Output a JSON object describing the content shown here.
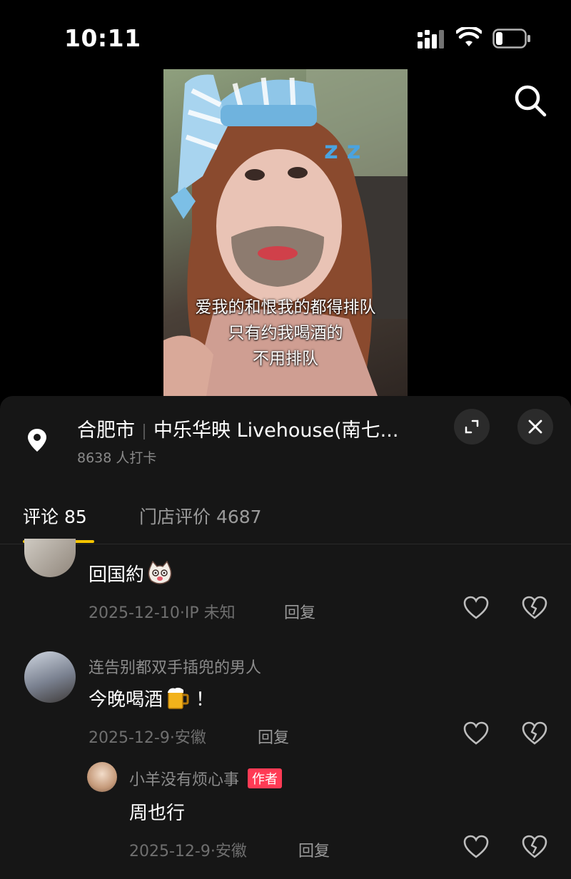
{
  "status_bar": {
    "time": "10:11",
    "icons": [
      "signal-icon",
      "wifi-icon",
      "battery-icon"
    ]
  },
  "header": {
    "search_icon": "search-icon"
  },
  "video": {
    "caption_lines": [
      "爱我的和恨我的都得排队",
      "只有约我喝酒的",
      "不用排队"
    ]
  },
  "location": {
    "city": "合肥市",
    "venue": "中乐华映 Livehouse(南七...",
    "checkins": "8638 人打卡",
    "icons": [
      "location-pin-icon",
      "expand-icon",
      "close-icon"
    ]
  },
  "tabs": [
    {
      "label": "评论 85",
      "active": true
    },
    {
      "label": "门店评价 4687",
      "active": false
    }
  ],
  "comments": [
    {
      "text": "回国約",
      "date": "2025-12-10·IP 未知",
      "reply_label": "回复",
      "emoji": "cat-face-emoji"
    },
    {
      "author": "连告别都双手插兜的男人",
      "text": "今晚喝酒",
      "text_suffix": "！",
      "date": "2025-12-9·安徽",
      "reply_label": "回复",
      "emoji": "beer-mug-emoji"
    },
    {
      "author": "小羊没有烦心事",
      "badge": "作者",
      "text": "周也行",
      "date": "2025-12-9·安徽",
      "reply_label": "回复",
      "is_reply": true
    }
  ],
  "colors": {
    "background": "#000000",
    "sheet": "#161616",
    "accent_underline": "#f5c400",
    "author_badge": "#ff3b55"
  }
}
